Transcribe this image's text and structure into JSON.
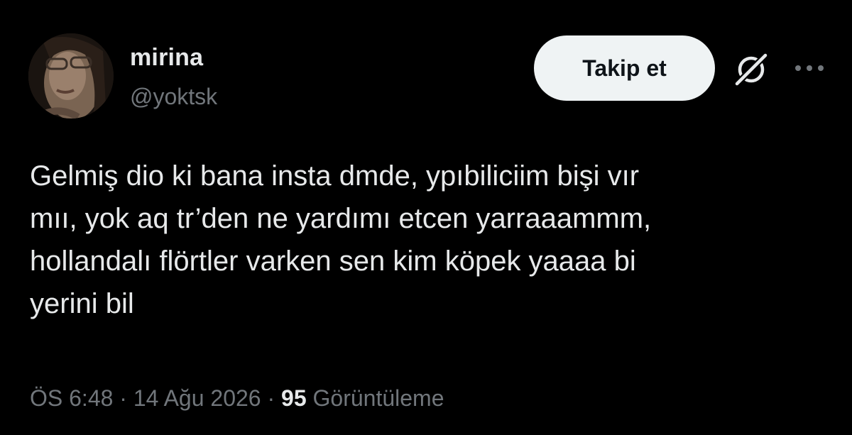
{
  "user": {
    "display_name": "mirina",
    "handle": "@yoktsk",
    "avatar_icon": "user-avatar-photo"
  },
  "actions": {
    "follow_label": "Takip et",
    "grok_icon": "grok-icon",
    "more_icon": "more-dots-icon"
  },
  "tweet": {
    "text": "Gelmiş dio ki bana insta dmde, ypıbiliciim bişi vır\nmıı, yok aq tr’den ne yardımı etcen yarraaammm,\nhollandalı flörtler varken sen kim köpek yaaaa bi\nyerini bil"
  },
  "meta": {
    "time": "ÖS 6:48",
    "separator": " · ",
    "date": "14 Ağu 2026",
    "views_count": "95",
    "views_label": "Görüntüleme"
  },
  "colors": {
    "background": "#000000",
    "primary_text": "#e7e9ea",
    "secondary_text": "#71767b",
    "follow_button_bg": "#eff3f4",
    "follow_button_text": "#0f1419"
  }
}
